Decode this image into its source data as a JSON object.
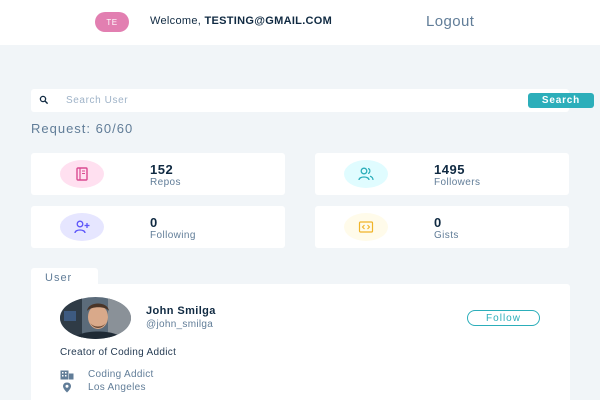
{
  "navbar": {
    "avatar_initials": "TE",
    "welcome_prefix": "Welcome, ",
    "user_email": "TESTING@GMAIL.COM",
    "logout_label": "Logout"
  },
  "search": {
    "placeholder": "Search User",
    "value": "",
    "button_label": "Search"
  },
  "requests": {
    "text": "Request: 60/60"
  },
  "stats": [
    {
      "value": "152",
      "label": "Repos",
      "icon": "book-icon",
      "color": "#da4a91",
      "bg": "#ffe0f0"
    },
    {
      "value": "1495",
      "label": "Followers",
      "icon": "users-icon",
      "color": "#2caeba",
      "bg": "#e0fcff"
    },
    {
      "value": "0",
      "label": "Following",
      "icon": "user-plus-icon",
      "color": "#5d55fa",
      "bg": "#e6e6ff"
    },
    {
      "value": "0",
      "label": "Gists",
      "icon": "code-icon",
      "color": "#f0b429",
      "bg": "#fffbea"
    }
  ],
  "user_card": {
    "tab_label": "User",
    "name": "John Smilga",
    "handle": "@john_smilga",
    "follow_label": "Follow",
    "bio": "Creator of Coding Addict",
    "company": "Coding Addict",
    "location": "Los Angeles"
  },
  "colors": {
    "accent": "#2caeba",
    "background": "#f1f5f8",
    "text_dark": "#102a42",
    "text_muted": "#617d98"
  }
}
